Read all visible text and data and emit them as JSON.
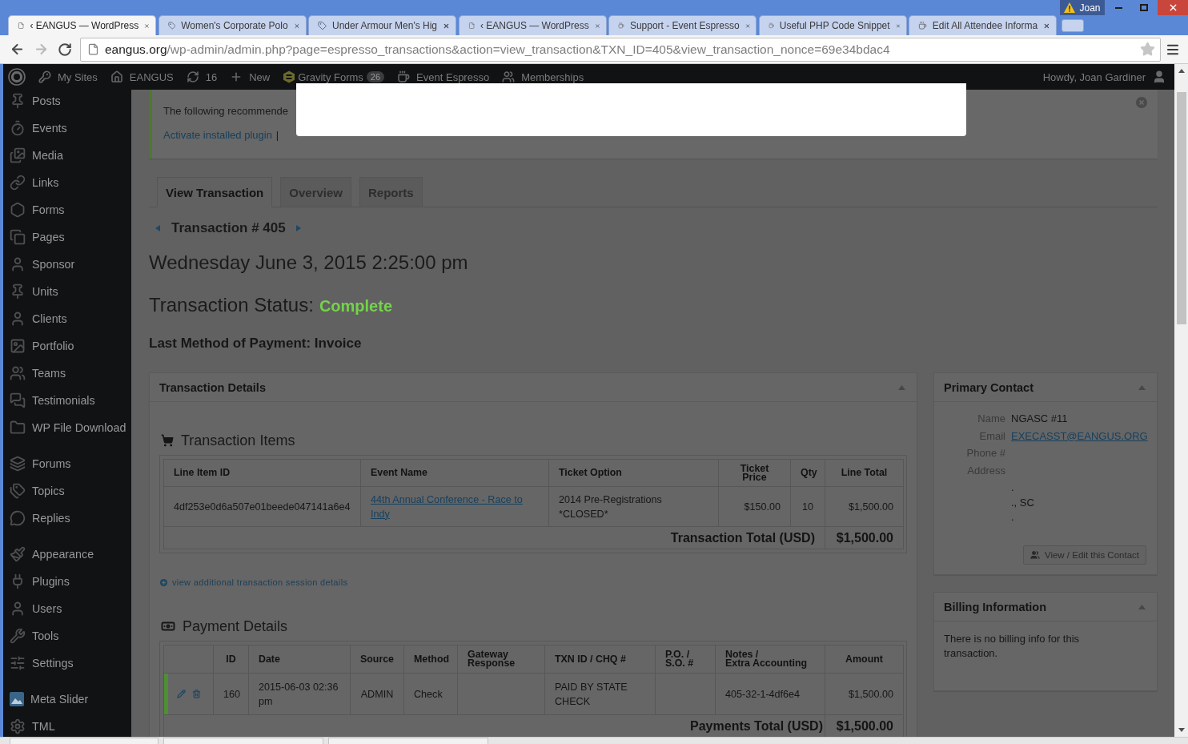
{
  "browser": {
    "tabs": [
      {
        "title": "‹ EANGUS — WordPress",
        "kind": "page",
        "selected": true
      },
      {
        "title": "Women's Corporate Polo",
        "kind": "tag",
        "selected": false
      },
      {
        "title": "Under Armour Men's Hig",
        "kind": "tag",
        "selected": false
      },
      {
        "title": "‹ EANGUS — WordPress",
        "kind": "page",
        "selected": false
      },
      {
        "title": "Support - Event Espresso",
        "kind": "cup",
        "selected": false
      },
      {
        "title": "Useful PHP Code Snippet",
        "kind": "cup",
        "selected": false
      },
      {
        "title": "Edit All Attendee Informa",
        "kind": "cup",
        "selected": false
      }
    ],
    "profile": "Joan",
    "url": "**eangus.org**/wp-admin/admin.php?page=espresso_transactions&action=view_transaction&TXN_ID=405&view_transaction_nonce=69e34bdac4"
  },
  "admin_bar": {
    "items": [
      {
        "label": "My Sites"
      },
      {
        "label": "EANGUS"
      },
      {
        "label": "16"
      },
      {
        "label": "New"
      },
      {
        "label": "Gravity Forms",
        "badge": "26"
      },
      {
        "label": "Event Espresso"
      },
      {
        "label": "Memberships"
      }
    ],
    "greeting": "Howdy, Joan Gardiner"
  },
  "sidebar": {
    "groups": [
      {
        "items": [
          {
            "label": "Posts"
          },
          {
            "label": "Events"
          },
          {
            "label": "Media"
          },
          {
            "label": "Links"
          },
          {
            "label": "Forms"
          },
          {
            "label": "Pages"
          },
          {
            "label": "Sponsor"
          },
          {
            "label": "Units"
          },
          {
            "label": "Clients"
          },
          {
            "label": "Portfolio"
          },
          {
            "label": "Teams"
          },
          {
            "label": "Testimonials"
          },
          {
            "label": "WP File Download"
          }
        ]
      },
      {
        "items": [
          {
            "label": "Forums"
          },
          {
            "label": "Topics"
          },
          {
            "label": "Replies"
          }
        ]
      },
      {
        "items": [
          {
            "label": "Appearance"
          },
          {
            "label": "Plugins"
          },
          {
            "label": "Users"
          },
          {
            "label": "Tools"
          },
          {
            "label": "Settings"
          }
        ]
      },
      {
        "items": [
          {
            "label": "Meta Slider"
          },
          {
            "label": "TML"
          }
        ]
      }
    ]
  },
  "notice": {
    "text": "The following recommende",
    "link": "Activate installed plugin",
    "separator": "|"
  },
  "tabs": [
    {
      "label": "View Transaction",
      "selected": true
    },
    {
      "label": "Overview",
      "selected": false
    },
    {
      "label": "Reports",
      "selected": false
    }
  ],
  "transaction": {
    "number": "Transaction # 405",
    "date": "Wednesday June 3, 2015 2:25:00 pm",
    "status_label": "Transaction Status:",
    "status": "Complete",
    "payment_method": "Last Method of Payment: Invoice"
  },
  "transaction_details": {
    "title": "Transaction Details",
    "expanded": true,
    "items_heading": "Transaction Items",
    "items_table": {
      "columns": [
        "Line Item ID",
        "Event Name",
        "Ticket Option",
        "Ticket\nPrice",
        "Qty",
        "Line Total"
      ],
      "rows": [
        {
          "line_item_id": "4df253e0d6a507e01beede047141a6e4",
          "event_name": "44th Annual Conference - Race to Indy",
          "ticket_option": "2014 Pre-Registrations *CLOSED*",
          "ticket_price": "$150.00",
          "qty": "10",
          "line_total": "$1,500.00"
        }
      ],
      "total_label": "Transaction Total (USD)",
      "total": "$1,500.00"
    },
    "session_link": "view additional transaction session details",
    "payments_heading": "Payment Details",
    "payments_table": {
      "columns": [
        "ID",
        "Date",
        "Source",
        "Method",
        "Gateway\nResponse",
        "TXN ID / CHQ #",
        "P.O. /\nS.O. #",
        "Notes /\nExtra Accounting",
        "Amount"
      ],
      "rows": [
        {
          "color": "#4e8f33",
          "id": "160",
          "date": "2015-06-03 02:36 pm",
          "source": "ADMIN",
          "method": "Check",
          "txn_id": "PAID BY STATE CHECK",
          "notes": "405-32-1-4df6e4",
          "amount": "$1,500.00"
        }
      ],
      "total_label": "Payments Total (USD)",
      "total": "$1,500.00"
    }
  },
  "primary_contact": {
    "title": "Primary Contact",
    "expanded": true,
    "fields": [
      {
        "label": "Name",
        "value": "NGASC #11",
        "kind": "text"
      },
      {
        "label": "Email",
        "value": "EXECASST@EANGUS.ORG",
        "kind": "link"
      },
      {
        "label": "Phone #"
      },
      {
        "label": "Address"
      }
    ],
    "address_lines": [
      ".",
      "., SC",
      "."
    ],
    "button": "View / Edit this Contact"
  },
  "billing": {
    "title": "Billing Information",
    "expanded": true,
    "text": "There is no billing info for this transaction."
  }
}
